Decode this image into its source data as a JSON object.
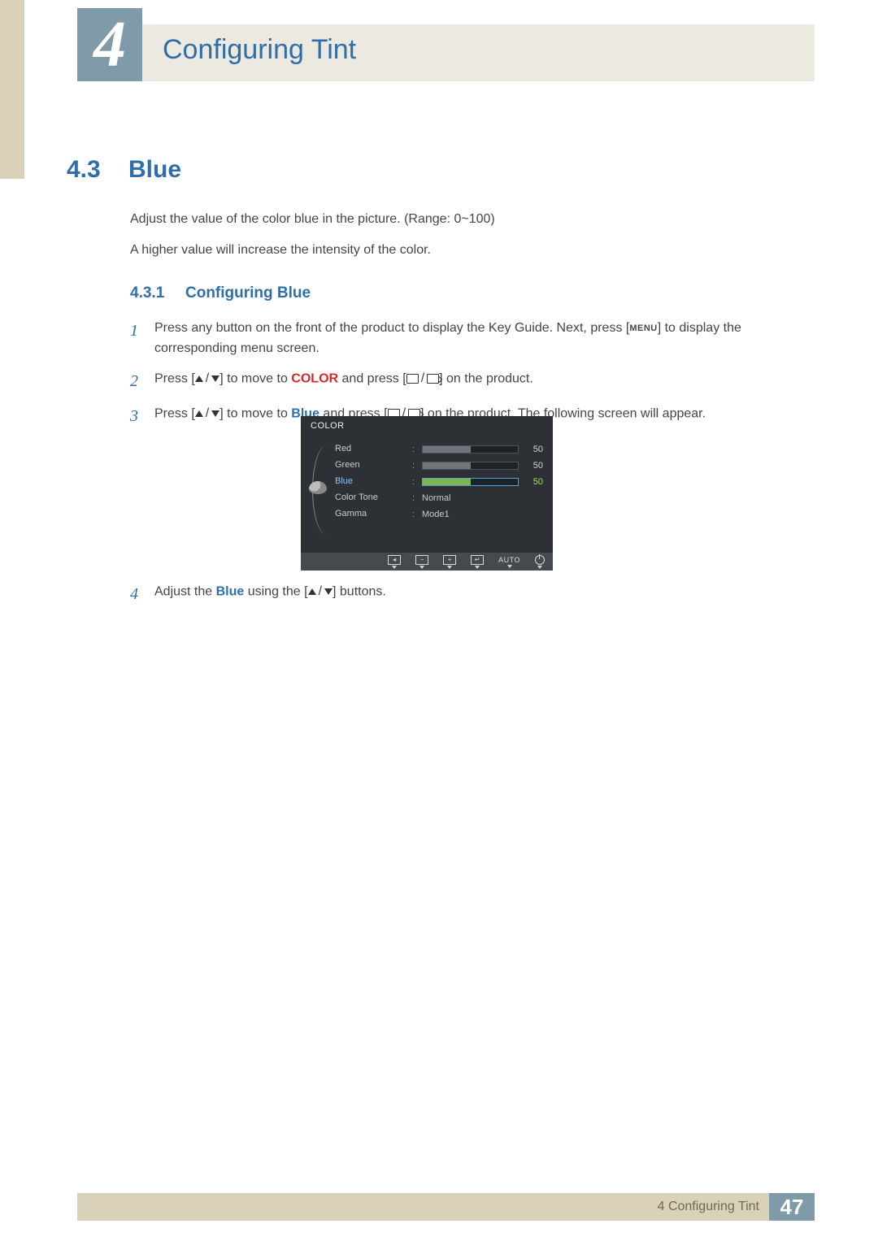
{
  "header": {
    "chapter_number": "4",
    "chapter_title": "Configuring Tint"
  },
  "section": {
    "number": "4.3",
    "title": "Blue",
    "paragraphs": {
      "p1": "Adjust the value of the color blue in the picture. (Range: 0~100)",
      "p2": "A higher value will increase the intensity of the color."
    }
  },
  "subsection": {
    "number": "4.3.1",
    "title": "Configuring Blue"
  },
  "steps": {
    "s1": {
      "num": "1",
      "before": "Press any button on the front of the product to display the Key Guide. Next, press [",
      "menu": "MENU",
      "after": "] to display the corresponding menu screen."
    },
    "s2": {
      "num": "2",
      "a": "Press [",
      "b": "] to move to ",
      "kw": "COLOR",
      "c": " and press [",
      "d": "] on the product."
    },
    "s3": {
      "num": "3",
      "a": "Press [",
      "b": "] to move to ",
      "kw": "Blue",
      "c": " and press [",
      "d": "] on the product. The following screen will appear."
    },
    "s4": {
      "num": "4",
      "a": "Adjust the ",
      "kw": "Blue",
      "b": " using the [",
      "c": "] buttons."
    }
  },
  "osd": {
    "title": "COLOR",
    "items": {
      "red": "Red",
      "green": "Green",
      "blue": "Blue",
      "colortone": "Color Tone",
      "gamma": "Gamma"
    },
    "values": {
      "red": "50",
      "green": "50",
      "blue": "50",
      "colortone": "Normal",
      "gamma": "Mode1"
    },
    "footer": {
      "auto": "AUTO"
    }
  },
  "footer": {
    "label": "4 Configuring Tint",
    "page": "47"
  }
}
